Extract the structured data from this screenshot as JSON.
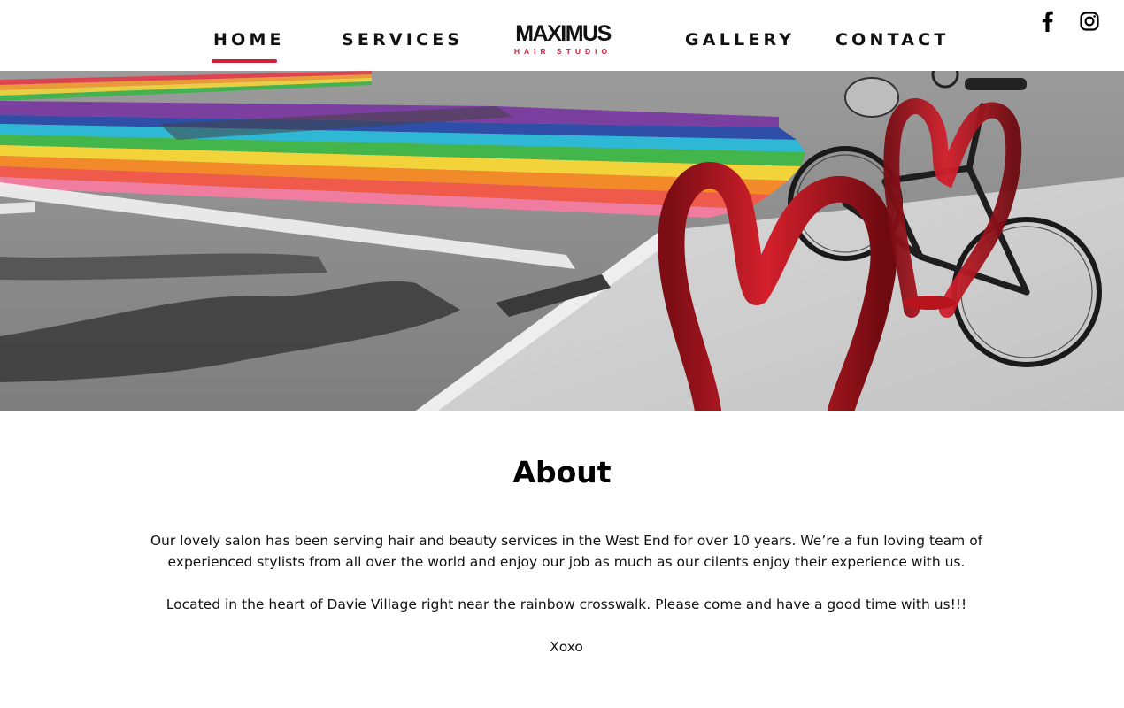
{
  "nav": {
    "items": [
      {
        "label": "HOME",
        "active": true
      },
      {
        "label": "SERVICES",
        "active": false
      },
      {
        "label": "GALLERY",
        "active": false
      },
      {
        "label": "CONTACT",
        "active": false
      }
    ]
  },
  "logo": {
    "name": "MAXIMUS",
    "tagline": "HAIR STUDIO"
  },
  "social": [
    "facebook-icon",
    "instagram-icon"
  ],
  "hero": {
    "description_icon": "rainbow-crosswalk-heart-bike-rack-photo"
  },
  "about": {
    "title": "About",
    "paragraph1": "Our lovely salon has been serving hair and beauty services in the West End for over 10 years. We’re a fun loving team of experienced stylists from all over the world and enjoy our job as much as our cilents enjoy their experience with us.",
    "paragraph2": "Located in the heart of Davie Village right near the rainbow crosswalk. Please come and have a good time with us!!!",
    "signoff": "Xoxo"
  },
  "colors": {
    "accent": "#d01f3c",
    "text": "#111111",
    "background": "#ffffff"
  }
}
